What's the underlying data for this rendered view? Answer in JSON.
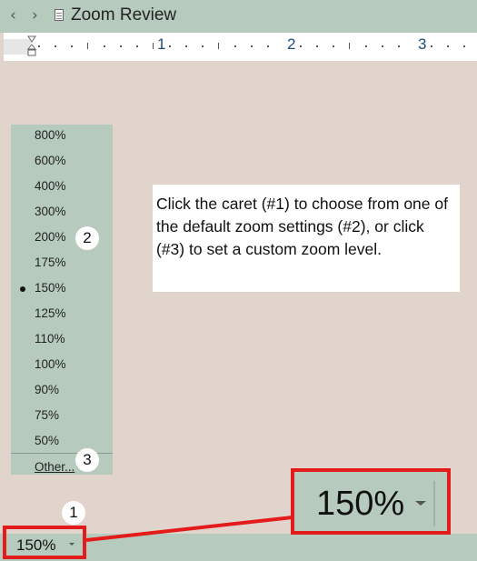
{
  "window": {
    "title": "Zoom Review",
    "back_icon": "chevron-left-icon",
    "forward_icon": "chevron-right-icon",
    "doc_icon": "document-icon"
  },
  "ruler": {
    "numbers": [
      "1",
      "2",
      "3"
    ]
  },
  "zoom_menu": {
    "items": [
      {
        "label": "800%",
        "selected": false
      },
      {
        "label": "600%",
        "selected": false
      },
      {
        "label": "400%",
        "selected": false
      },
      {
        "label": "300%",
        "selected": false
      },
      {
        "label": "200%",
        "selected": false
      },
      {
        "label": "175%",
        "selected": false
      },
      {
        "label": "150%",
        "selected": true
      },
      {
        "label": "125%",
        "selected": false
      },
      {
        "label": "110%",
        "selected": false
      },
      {
        "label": "100%",
        "selected": false
      },
      {
        "label": "90%",
        "selected": false
      },
      {
        "label": "75%",
        "selected": false
      },
      {
        "label": "50%",
        "selected": false
      }
    ],
    "other_label": "Other..."
  },
  "callout": {
    "text": "Click the caret (#1) to choose from one of the default zoom settings (#2), or click (#3) to set a custom zoom level."
  },
  "badges": {
    "one": "1",
    "two": "2",
    "three": "3"
  },
  "status": {
    "zoom_value": "150%"
  },
  "colors": {
    "chrome": "#b6cbbd",
    "canvas": "#e0d4cc",
    "highlight": "#e31b1b"
  }
}
